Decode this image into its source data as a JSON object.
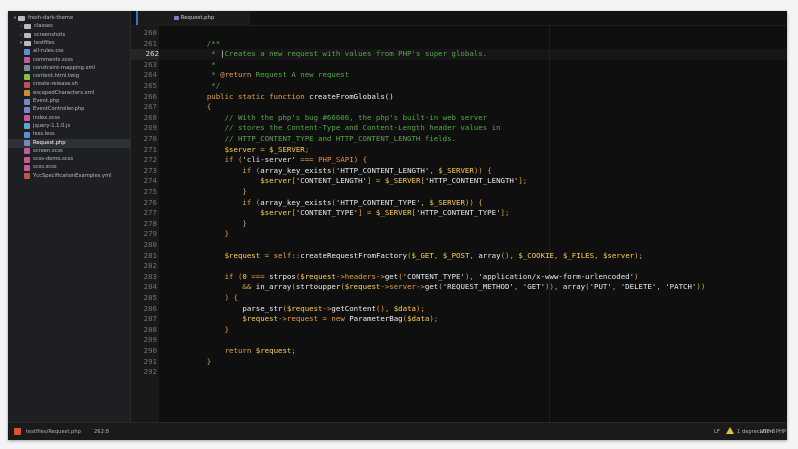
{
  "sidebar": {
    "items": [
      {
        "label": "fresh-dark-theme",
        "kind": "root",
        "chev": "▾",
        "color": "#b9bcc0",
        "indent": 0
      },
      {
        "label": "classes",
        "kind": "folder",
        "chev": "›",
        "color": "#b9bcc0",
        "indent": 1
      },
      {
        "label": "screenshots",
        "kind": "folder",
        "chev": "›",
        "color": "#b9bcc0",
        "indent": 1
      },
      {
        "label": "testfiles",
        "kind": "folder",
        "chev": "▾",
        "color": "#b9bcc0",
        "indent": 1
      },
      {
        "label": "all-rules.css",
        "kind": "file",
        "color": "#5f8fd9",
        "indent": 2
      },
      {
        "label": "comments.scss",
        "kind": "file",
        "color": "#c65a9a",
        "indent": 2
      },
      {
        "label": "constraint-mapping.xml",
        "kind": "file",
        "color": "#7d8ba3",
        "indent": 2
      },
      {
        "label": "content.html.twig",
        "kind": "file",
        "color": "#8bbf4a",
        "indent": 2
      },
      {
        "label": "create-release.sh",
        "kind": "file",
        "color": "#c45151",
        "indent": 2
      },
      {
        "label": "escapedCharacters.xml",
        "kind": "file",
        "color": "#cc8a3b",
        "indent": 2
      },
      {
        "label": "Event.php",
        "kind": "file",
        "color": "#7a86c2",
        "indent": 2
      },
      {
        "label": "EventController.php",
        "kind": "file",
        "color": "#7a86c2",
        "indent": 2
      },
      {
        "label": "index.scss",
        "kind": "file",
        "color": "#c65a9a",
        "indent": 2
      },
      {
        "label": "jquery-1.1.0.js",
        "kind": "file",
        "color": "#5fa7c9",
        "indent": 2
      },
      {
        "label": "less.less",
        "kind": "file",
        "color": "#5f8fd9",
        "indent": 2
      },
      {
        "label": "Request.php",
        "kind": "file",
        "color": "#7a86c2",
        "indent": 2,
        "selected": true
      },
      {
        "label": "screen.scss",
        "kind": "file",
        "color": "#c65a9a",
        "indent": 2
      },
      {
        "label": "scss-demo.scss",
        "kind": "file",
        "color": "#c65a9a",
        "indent": 2
      },
      {
        "label": "scss.scss",
        "kind": "file",
        "color": "#c65a9a",
        "indent": 2
      },
      {
        "label": "YccSpecificationExamples.yml",
        "kind": "file",
        "color": "#c45151",
        "indent": 2
      }
    ]
  },
  "tabs": [
    {
      "label": "Request.php",
      "active": true
    }
  ],
  "editor": {
    "active_line": 262,
    "lines": [
      {
        "n": "260",
        "segs": []
      },
      {
        "n": "261",
        "segs": [
          [
            "    /**",
            "cm"
          ]
        ]
      },
      {
        "n": "262",
        "segs": [
          [
            "     * ",
            "cm"
          ],
          [
            "|",
            "cur"
          ],
          [
            "Creates a new request with values from PHP's super globals.",
            "cm"
          ]
        ]
      },
      {
        "n": "263",
        "segs": [
          [
            "     *",
            "cm"
          ]
        ]
      },
      {
        "n": "264",
        "segs": [
          [
            "     * ",
            "cm"
          ],
          [
            "@return",
            "dt"
          ],
          [
            " Request A new request",
            "cm"
          ]
        ]
      },
      {
        "n": "265",
        "segs": [
          [
            "     */",
            "cm"
          ]
        ]
      },
      {
        "n": "266",
        "segs": [
          [
            "    ",
            ""
          ],
          [
            "public static function ",
            "kw"
          ],
          [
            "createFromGlobals()",
            "fn"
          ]
        ]
      },
      {
        "n": "267",
        "segs": [
          [
            "    {",
            "op"
          ]
        ]
      },
      {
        "n": "268",
        "segs": [
          [
            "        // With the php's bug #66606, the php's built-in web server",
            "cm"
          ]
        ]
      },
      {
        "n": "269",
        "segs": [
          [
            "        // stores the Content-Type and Content-Length header values in",
            "cm"
          ]
        ]
      },
      {
        "n": "270",
        "segs": [
          [
            "        // HTTP_CONTENT_TYPE and HTTP_CONTENT_LENGTH fields.",
            "cm"
          ]
        ]
      },
      {
        "n": "271",
        "segs": [
          [
            "        ",
            ""
          ],
          [
            "$server",
            "var"
          ],
          [
            " = ",
            "op"
          ],
          [
            "$_SERVER",
            "var"
          ],
          [
            ";",
            "op"
          ]
        ]
      },
      {
        "n": "272",
        "segs": [
          [
            "        ",
            ""
          ],
          [
            "if",
            "kw"
          ],
          [
            " (",
            "op"
          ],
          [
            "'cli-server'",
            "str"
          ],
          [
            " === ",
            "op"
          ],
          [
            "PHP_SAPI",
            "const"
          ],
          [
            ") {",
            "op"
          ]
        ]
      },
      {
        "n": "273",
        "segs": [
          [
            "            ",
            ""
          ],
          [
            "if",
            "kw"
          ],
          [
            " (",
            "op"
          ],
          [
            "array_key_exists",
            "fn"
          ],
          [
            "(",
            "op"
          ],
          [
            "'HTTP_CONTENT_LENGTH'",
            "str"
          ],
          [
            ", ",
            "op"
          ],
          [
            "$_SERVER",
            "var"
          ],
          [
            ")) {",
            "op"
          ]
        ]
      },
      {
        "n": "274",
        "segs": [
          [
            "                ",
            ""
          ],
          [
            "$server",
            "var"
          ],
          [
            "[",
            "op"
          ],
          [
            "'CONTENT_LENGTH'",
            "str"
          ],
          [
            "] = ",
            "op"
          ],
          [
            "$_SERVER",
            "var"
          ],
          [
            "[",
            "op"
          ],
          [
            "'HTTP_CONTENT_LENGTH'",
            "str"
          ],
          [
            "];",
            "op"
          ]
        ]
      },
      {
        "n": "275",
        "segs": [
          [
            "            }",
            "op"
          ]
        ]
      },
      {
        "n": "276",
        "segs": [
          [
            "            ",
            ""
          ],
          [
            "if",
            "kw"
          ],
          [
            " (",
            "op"
          ],
          [
            "array_key_exists",
            "fn"
          ],
          [
            "(",
            "op"
          ],
          [
            "'HTTP_CONTENT_TYPE'",
            "str"
          ],
          [
            ", ",
            "op"
          ],
          [
            "$_SERVER",
            "var"
          ],
          [
            ")) {",
            "op"
          ]
        ]
      },
      {
        "n": "277",
        "segs": [
          [
            "                ",
            ""
          ],
          [
            "$server",
            "var"
          ],
          [
            "[",
            "op"
          ],
          [
            "'CONTENT_TYPE'",
            "str"
          ],
          [
            "] = ",
            "op"
          ],
          [
            "$_SERVER",
            "var"
          ],
          [
            "[",
            "op"
          ],
          [
            "'HTTP_CONTENT_TYPE'",
            "str"
          ],
          [
            "];",
            "op"
          ]
        ]
      },
      {
        "n": "278",
        "segs": [
          [
            "            }",
            "op"
          ]
        ]
      },
      {
        "n": "279",
        "segs": [
          [
            "        }",
            "op"
          ]
        ]
      },
      {
        "n": "280",
        "segs": []
      },
      {
        "n": "281",
        "segs": [
          [
            "        ",
            ""
          ],
          [
            "$request",
            "var"
          ],
          [
            " = ",
            "op"
          ],
          [
            "self",
            "kw"
          ],
          [
            "::",
            "op"
          ],
          [
            "createRequestFromFactory",
            "fn"
          ],
          [
            "(",
            "op"
          ],
          [
            "$_GET",
            "var"
          ],
          [
            ", ",
            "op"
          ],
          [
            "$_POST",
            "var"
          ],
          [
            ", ",
            "op"
          ],
          [
            "array",
            "fn"
          ],
          [
            "(), ",
            "op"
          ],
          [
            "$_COOKIE",
            "var"
          ],
          [
            ", ",
            "op"
          ],
          [
            "$_FILES",
            "var"
          ],
          [
            ", ",
            "op"
          ],
          [
            "$server",
            "var"
          ],
          [
            ");",
            "op"
          ]
        ]
      },
      {
        "n": "282",
        "segs": []
      },
      {
        "n": "283",
        "segs": [
          [
            "        ",
            ""
          ],
          [
            "if",
            "kw"
          ],
          [
            " (",
            "op"
          ],
          [
            "0",
            "num"
          ],
          [
            " === ",
            "op"
          ],
          [
            "strpos",
            "fn"
          ],
          [
            "(",
            "op"
          ],
          [
            "$request",
            "var"
          ],
          [
            "->headers->",
            "op"
          ],
          [
            "get",
            "fn"
          ],
          [
            "(",
            "op"
          ],
          [
            "'CONTENT_TYPE'",
            "str"
          ],
          [
            "), ",
            "op"
          ],
          [
            "'application/x-www-form-urlencoded'",
            "str"
          ],
          [
            ")",
            "op"
          ]
        ]
      },
      {
        "n": "284",
        "segs": [
          [
            "            && ",
            "op"
          ],
          [
            "in_array",
            "fn"
          ],
          [
            "(",
            "op"
          ],
          [
            "strtoupper",
            "fn"
          ],
          [
            "(",
            "op"
          ],
          [
            "$request",
            "var"
          ],
          [
            "->server->",
            "op"
          ],
          [
            "get",
            "fn"
          ],
          [
            "(",
            "op"
          ],
          [
            "'REQUEST_METHOD'",
            "str"
          ],
          [
            ", ",
            "op"
          ],
          [
            "'GET'",
            "str"
          ],
          [
            ")), ",
            "op"
          ],
          [
            "array",
            "fn"
          ],
          [
            "(",
            "op"
          ],
          [
            "'PUT'",
            "str"
          ],
          [
            ", ",
            "op"
          ],
          [
            "'DELETE'",
            "str"
          ],
          [
            ", ",
            "op"
          ],
          [
            "'PATCH'",
            "str"
          ],
          [
            "))",
            "op"
          ]
        ]
      },
      {
        "n": "285",
        "segs": [
          [
            "        ) {",
            "op"
          ]
        ]
      },
      {
        "n": "286",
        "segs": [
          [
            "            ",
            ""
          ],
          [
            "parse_str",
            "fn"
          ],
          [
            "(",
            "op"
          ],
          [
            "$request",
            "var"
          ],
          [
            "->",
            "op"
          ],
          [
            "getContent",
            "fn"
          ],
          [
            "(), ",
            "op"
          ],
          [
            "$data",
            "var"
          ],
          [
            ");",
            "op"
          ]
        ]
      },
      {
        "n": "287",
        "segs": [
          [
            "            ",
            ""
          ],
          [
            "$request",
            "var"
          ],
          [
            "->request = ",
            "op"
          ],
          [
            "new ",
            "kw"
          ],
          [
            "ParameterBag",
            "fn"
          ],
          [
            "(",
            "op"
          ],
          [
            "$data",
            "var"
          ],
          [
            ");",
            "op"
          ]
        ]
      },
      {
        "n": "288",
        "segs": [
          [
            "        }",
            "op"
          ]
        ]
      },
      {
        "n": "289",
        "segs": []
      },
      {
        "n": "290",
        "segs": [
          [
            "        ",
            ""
          ],
          [
            "return ",
            "kw"
          ],
          [
            "$request",
            "var"
          ],
          [
            ";",
            "op"
          ]
        ]
      },
      {
        "n": "291",
        "segs": [
          [
            "    }",
            "op"
          ]
        ]
      },
      {
        "n": "292",
        "segs": []
      }
    ]
  },
  "syntax_colors": {
    "cm": "#57a64a",
    "kw": "#e6a23c",
    "fn": "#f0f0f0",
    "var": "#ffd24a",
    "str": "#e9e9e9",
    "const": "#f08a3e",
    "op": "#e6a23c",
    "num": "#ffd24a",
    "dt": "#e6a23c",
    "cur": "#e6e6e6",
    "": "#e6e6e6"
  },
  "status": {
    "file_path": "testfiles/Request.php",
    "cursor": "262:8",
    "line_ending": "LF",
    "warnings": "1 deprecation",
    "encoding": "UTF-8",
    "grammar": "PHP"
  }
}
